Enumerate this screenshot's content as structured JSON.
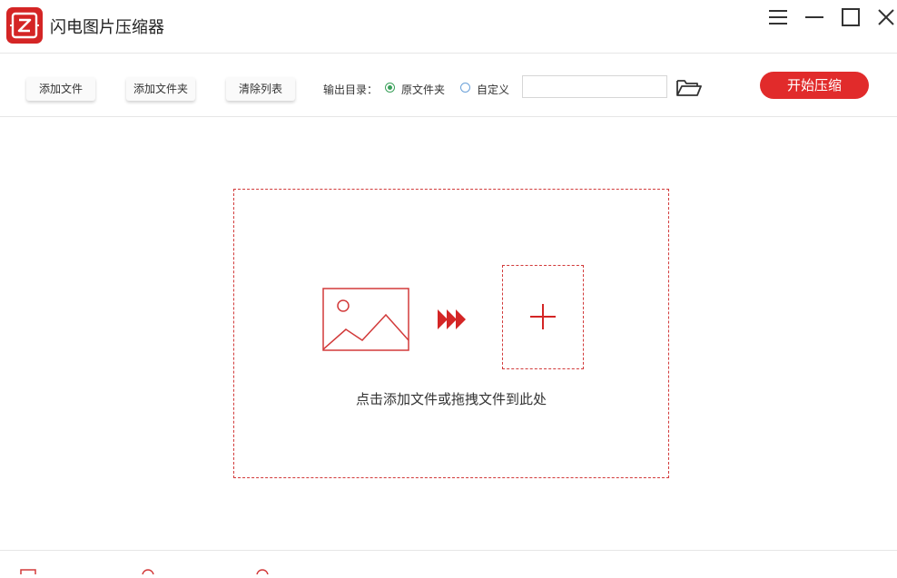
{
  "app": {
    "title": "闪电图片压缩器",
    "accent": "#e12b2b"
  },
  "window_controls": {
    "menu_icon": "hamburger-menu-icon",
    "minimize_icon": "minimize-icon",
    "maximize_icon": "maximize-icon",
    "close_icon": "close-icon"
  },
  "toolbar": {
    "add_file": "添加文件",
    "add_folder": "添加文件夹",
    "clear_list": "清除列表",
    "output_label": "输出目录：",
    "output_options": [
      {
        "label": "原文件夹",
        "checked": true
      },
      {
        "label": "自定义",
        "checked": false
      }
    ],
    "output_path_value": "",
    "browse_icon": "folder-open-icon",
    "start": "开始压缩"
  },
  "drop_zone": {
    "hint": "点击添加文件或拖拽文件到此处",
    "image_icon": "image-icon",
    "arrow_icon": "triple-arrow-icon",
    "add_icon": "plus-icon"
  }
}
